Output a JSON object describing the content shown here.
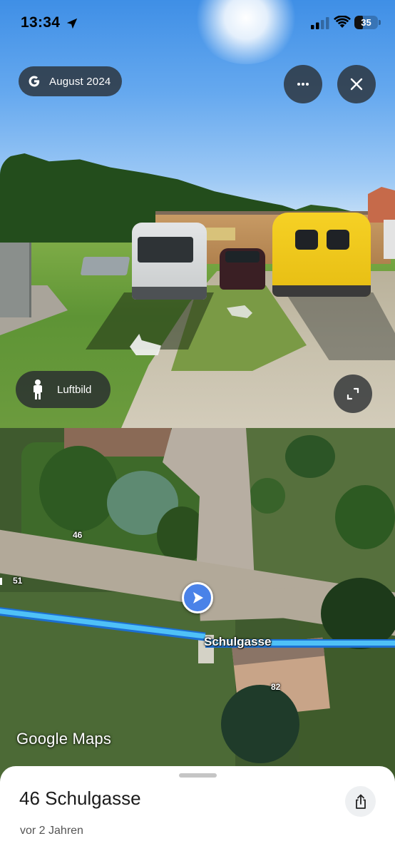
{
  "status_bar": {
    "time": "13:34",
    "battery_level": "35",
    "battery_fraction": 0.35,
    "icons": [
      "location-arrow-icon",
      "cellular-signal-icon",
      "wifi-icon",
      "battery-icon"
    ]
  },
  "street_view": {
    "capture_date": "August 2024",
    "date_chip_icon": "google-g-icon",
    "more_icon": "more-horizontal-icon",
    "close_icon": "close-icon",
    "aerial_toggle_label": "Luftbild",
    "aerial_toggle_icon": "pegman-icon",
    "expand_icon": "expand-icon"
  },
  "map": {
    "street_label": "Schulgasse",
    "house_numbers": [
      "46",
      "51",
      "82"
    ],
    "brand": "Google Maps",
    "route_color": "#4fc1f7",
    "pegman_color": "#4a82e8"
  },
  "place_sheet": {
    "title": "46 Schulgasse",
    "subtitle": "vor 2 Jahren",
    "share_icon": "share-icon"
  }
}
